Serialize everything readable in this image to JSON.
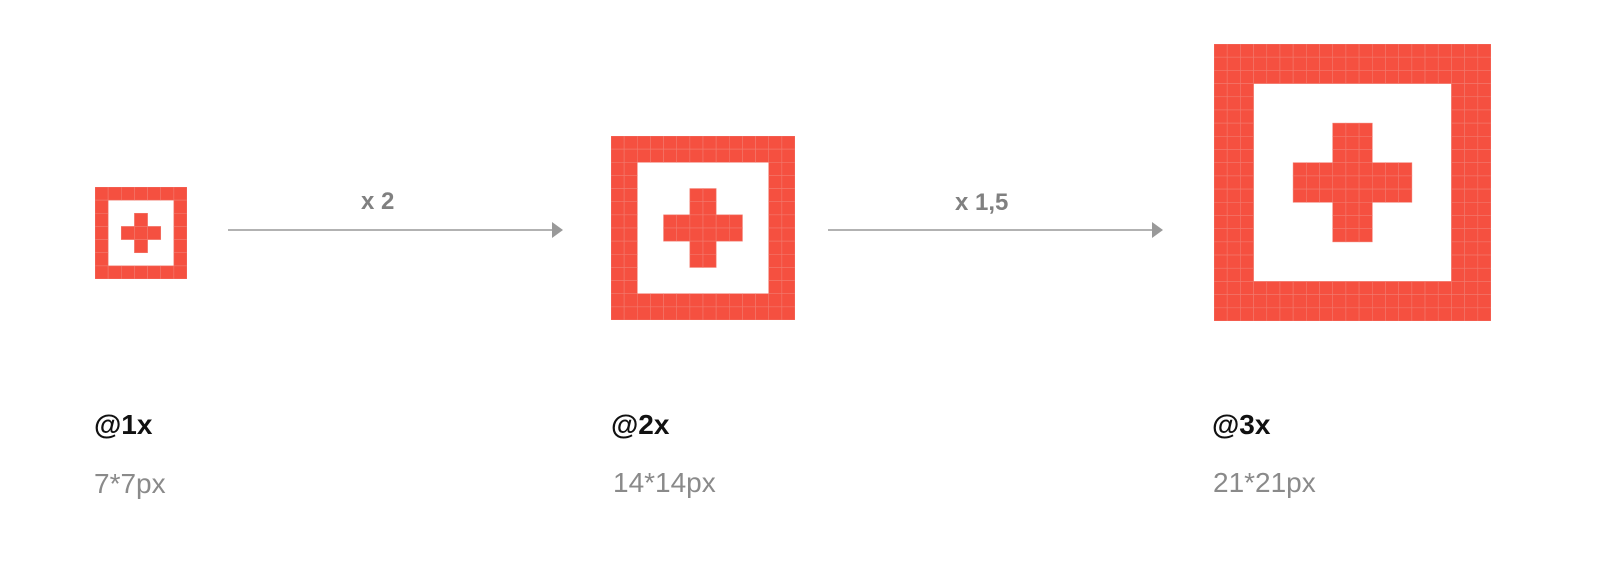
{
  "colors": {
    "icon_fill": "#f55040",
    "grid_line": "#f27a6e",
    "arrow": "#999999",
    "label_dark": "#111111",
    "label_muted": "#8a8a8a"
  },
  "icon_pattern": [
    "1111111",
    "1000001",
    "1001001",
    "1011101",
    "1001001",
    "1000001",
    "1111111"
  ],
  "variants": [
    {
      "scale": "@1x",
      "size": "7*7px",
      "grid": 7
    },
    {
      "scale": "@2x",
      "size": "14*14px",
      "grid": 14
    },
    {
      "scale": "@3x",
      "size": "21*21px",
      "grid": 21
    }
  ],
  "arrows": [
    {
      "label": "x 2"
    },
    {
      "label": "x 1,5"
    }
  ]
}
